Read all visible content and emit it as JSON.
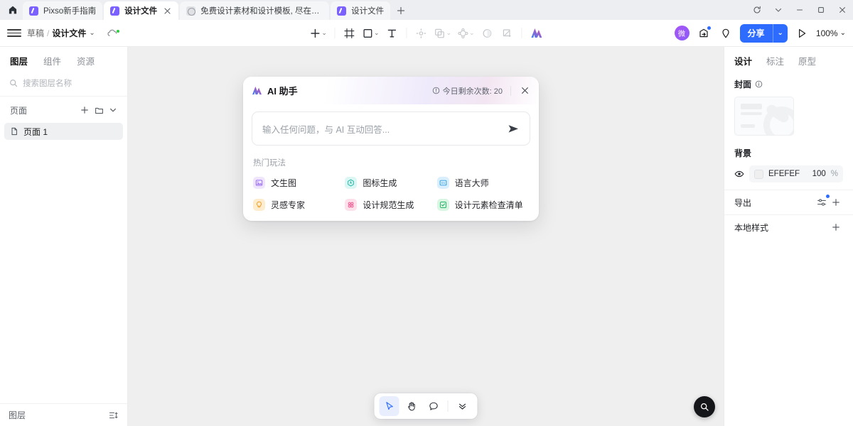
{
  "browser": {
    "home_tooltip": "Home",
    "tabs": [
      {
        "title": "Pixso新手指南",
        "favicon": "pixso-icon",
        "active": false,
        "closable": false
      },
      {
        "title": "设计文件",
        "favicon": "pixso-icon",
        "active": true,
        "closable": true
      },
      {
        "title": "免费设计素材和设计模板, 尽在Pixso资源社区",
        "favicon": "globe-icon",
        "active": false,
        "closable": false
      },
      {
        "title": "设计文件",
        "favicon": "pixso-icon",
        "active": false,
        "closable": false
      }
    ],
    "new_tab_label": "+",
    "window_controls": [
      "reload-icon",
      "chevron-down-icon",
      "minimize-icon",
      "maximize-icon",
      "close-icon"
    ]
  },
  "topbar": {
    "menu_icon": "hamburger-icon",
    "breadcrumb": {
      "parent": "草稿",
      "separator": "/",
      "current": "设计文件",
      "chevron": "⌄"
    },
    "cloud_status_icon": "cloud-sync-icon",
    "tools": [
      {
        "name": "add-tool",
        "icon": "plus-icon",
        "chevron": true,
        "muted": false
      },
      {
        "name": "frame-tool",
        "icon": "frame-icon",
        "chevron": false,
        "muted": false
      },
      {
        "name": "shape-tool",
        "icon": "rectangle-icon",
        "chevron": true,
        "muted": false
      },
      {
        "name": "text-tool",
        "icon": "text-t-icon",
        "chevron": false,
        "muted": false
      },
      {
        "name": "vector-tool",
        "icon": "vector-node-icon",
        "chevron": false,
        "muted": true
      },
      {
        "name": "component-tool",
        "icon": "copy-layers-icon",
        "chevron": true,
        "muted": true
      },
      {
        "name": "plugin-tool",
        "icon": "component-icon",
        "chevron": true,
        "muted": true
      },
      {
        "name": "mask-tool",
        "icon": "half-circle-icon",
        "chevron": false,
        "muted": true
      },
      {
        "name": "slice-tool",
        "icon": "crop-icon",
        "chevron": false,
        "muted": true
      },
      {
        "name": "ai-tool",
        "icon": "ai-logo-icon",
        "chevron": false,
        "muted": false
      }
    ],
    "avatar_text": "微",
    "present_icon": "play-icon",
    "share_label": "分享",
    "share_chevron": "⌄",
    "zoom_level": "100%",
    "zoom_chevron": "⌄"
  },
  "left_panel": {
    "tabs": [
      {
        "label": "图层",
        "active": true
      },
      {
        "label": "组件",
        "active": false
      },
      {
        "label": "资源",
        "active": false
      }
    ],
    "search_placeholder": "搜索图层名称",
    "section": {
      "title": "页面",
      "actions": [
        "plus-icon",
        "folder-icon",
        "chevron-down-icon"
      ]
    },
    "pages": [
      {
        "label": "页面 1",
        "selected": true
      }
    ],
    "footer": {
      "label": "图层",
      "action_icon": "sort-options-icon"
    }
  },
  "ai_panel": {
    "logo_icon": "ai-logo-icon",
    "title": "AI 助手",
    "quota_icon": "info-circle-icon",
    "quota_label": "今日剩余次数: 20",
    "close_icon": "close-icon",
    "input_placeholder": "输入任何问题，与 AI 互动回答...",
    "send_icon": "send-arrow-icon",
    "hot_title": "热门玩法",
    "hot_items": [
      {
        "label": "文生图",
        "icon": "image-icon",
        "bg": "#efe6fd",
        "fg": "#9b6cf0"
      },
      {
        "label": "图标生成",
        "icon": "hexagon-icon",
        "bg": "#dcf6f3",
        "fg": "#23b7a8"
      },
      {
        "label": "语言大师",
        "icon": "en-badge-icon",
        "bg": "#d9effd",
        "fg": "#2d9cdb"
      },
      {
        "label": "灵感专家",
        "icon": "lightbulb-icon",
        "bg": "#fdeccd",
        "fg": "#f0a02a"
      },
      {
        "label": "设计规范生成",
        "icon": "four-dots-icon",
        "bg": "#fde0ea",
        "fg": "#f0568f"
      },
      {
        "label": "设计元素检查清单",
        "icon": "checkbox-icon",
        "bg": "#d9f6e3",
        "fg": "#27b368"
      }
    ]
  },
  "canvas_toolbar": {
    "buttons": [
      {
        "name": "select-tool",
        "icon": "cursor-icon",
        "selected": true
      },
      {
        "name": "hand-tool",
        "icon": "hand-icon",
        "selected": false
      },
      {
        "name": "comment-tool",
        "icon": "comment-bubble-icon",
        "selected": false
      },
      {
        "name": "more-tools",
        "icon": "chevrons-down-icon",
        "selected": false
      }
    ],
    "search_fab_icon": "search-icon"
  },
  "right_panel": {
    "tabs": [
      {
        "label": "设计",
        "active": true
      },
      {
        "label": "标注",
        "active": false
      },
      {
        "label": "原型",
        "active": false
      }
    ],
    "cover": {
      "label": "封面",
      "info_icon": "info-circle-icon"
    },
    "background": {
      "label": "背景",
      "visibility_icon": "eye-icon",
      "color_hex": "EFEFEF",
      "opacity": "100",
      "opacity_unit": "%"
    },
    "export": {
      "label": "导出",
      "settings_icon": "sliders-icon",
      "add_icon": "plus-icon",
      "has_badge": true
    },
    "local_styles": {
      "label": "本地样式",
      "add_icon": "plus-icon"
    }
  },
  "colors": {
    "accent_blue": "#2d6cff",
    "canvas_bg": "#efefef",
    "panel_bg": "#ffffff",
    "chrome_bg": "#eceef1"
  }
}
